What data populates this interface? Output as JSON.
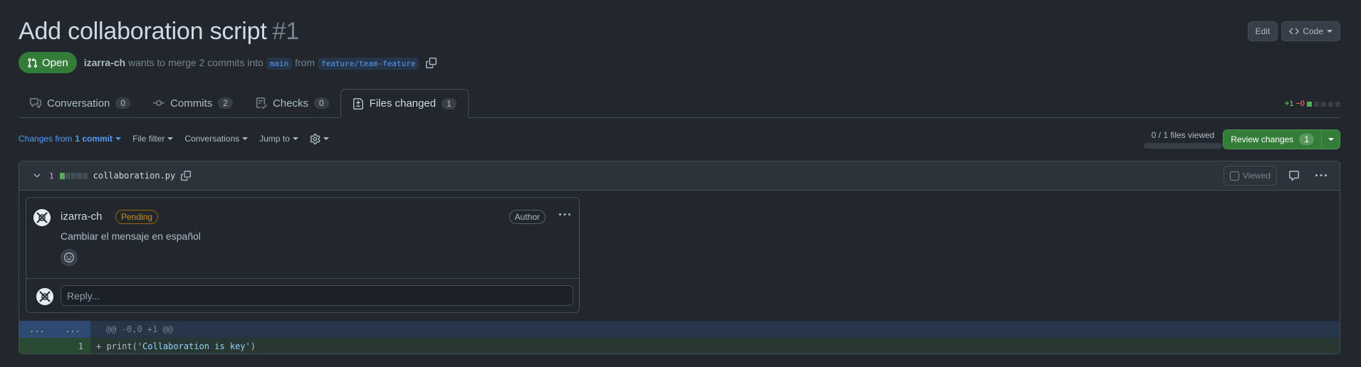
{
  "pr": {
    "title": "Add collaboration script",
    "number": "#1",
    "state": "Open",
    "author": "izarra-ch",
    "merge_text": "wants to merge 2 commits into",
    "base_branch": "main",
    "from_text": "from",
    "head_branch": "feature/team-feature"
  },
  "header_actions": {
    "edit": "Edit",
    "code": "Code"
  },
  "tabs": [
    {
      "label": "Conversation",
      "count": "0"
    },
    {
      "label": "Commits",
      "count": "2"
    },
    {
      "label": "Checks",
      "count": "0"
    },
    {
      "label": "Files changed",
      "count": "1"
    }
  ],
  "diffstat": {
    "additions": "+1",
    "deletions": "−0"
  },
  "toolbar": {
    "changes_prefix": "Changes from",
    "changes_bold": "1 commit",
    "file_filter": "File filter",
    "conversations": "Conversations",
    "jump_to": "Jump to"
  },
  "files_viewed": "0 / 1 files viewed",
  "review": {
    "label": "Review changes",
    "count": "1"
  },
  "file": {
    "change_count": "1",
    "name": "collaboration.py",
    "viewed_label": "Viewed"
  },
  "comment": {
    "author": "izarra-ch",
    "status": "Pending",
    "role": "Author",
    "body": "Cambiar el mensaje en español"
  },
  "reply": {
    "placeholder": "Reply..."
  },
  "diff": {
    "hunk": {
      "left": "...",
      "right": "...",
      "text": "@@ -0,0 +1 @@"
    },
    "line": {
      "new_num": "1",
      "prefix": "+ ",
      "code_pre": "print(",
      "code_str": "'Collaboration is key'",
      "code_post": ")"
    }
  },
  "colors": {
    "accent_green": "#347d39",
    "link_blue": "#539bf5",
    "background": "#22272e",
    "pending": "#c69026"
  }
}
